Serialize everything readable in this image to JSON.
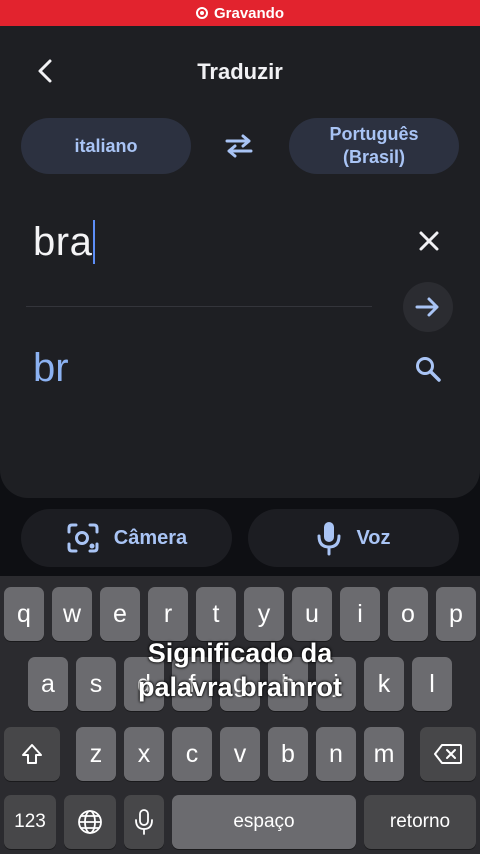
{
  "recording": {
    "label": "Gravando"
  },
  "header": {
    "title": "Traduzir",
    "back_icon": "arrow-back-icon"
  },
  "languages": {
    "source": "italiano",
    "target_line1": "Português",
    "target_line2": "(Brasil)",
    "swap_icon": "swap-arrows-icon"
  },
  "input": {
    "value": "bra"
  },
  "suggestion": {
    "text": "br"
  },
  "actions": {
    "camera_label": "Câmera",
    "voice_label": "Voz"
  },
  "keyboard": {
    "row1": [
      "q",
      "w",
      "e",
      "r",
      "t",
      "y",
      "u",
      "i",
      "o",
      "p"
    ],
    "row2": [
      "a",
      "s",
      "d",
      "f",
      "g",
      "h",
      "j",
      "k",
      "l"
    ],
    "row3": [
      "z",
      "x",
      "c",
      "v",
      "b",
      "n",
      "m"
    ],
    "numbers_label": "123",
    "space_label": "espaço",
    "return_label": "retorno"
  },
  "overlay": {
    "line1": "Significado da",
    "line2": "palavra brainrot"
  },
  "colors": {
    "accent": "#a9c4f5",
    "recording": "#e2232e",
    "caret": "#5d8ef7"
  }
}
